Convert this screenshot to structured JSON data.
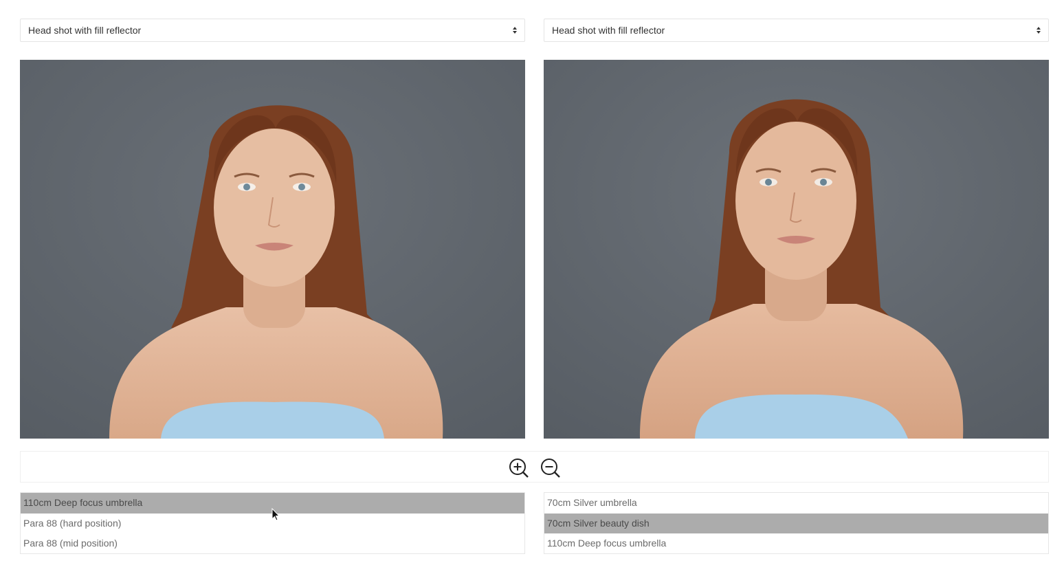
{
  "left": {
    "select_label": "Head shot with fill reflector",
    "options": [
      {
        "label": "110cm Deep focus umbrella",
        "selected": true
      },
      {
        "label": "Para 88 (hard position)",
        "selected": false
      },
      {
        "label": "Para 88 (mid position)",
        "selected": false
      }
    ]
  },
  "right": {
    "select_label": "Head shot with fill reflector",
    "options": [
      {
        "label": "70cm Silver umbrella",
        "selected": false
      },
      {
        "label": "70cm Silver beauty dish",
        "selected": true
      },
      {
        "label": "110cm Deep focus umbrella",
        "selected": false
      }
    ]
  },
  "toolbar": {
    "zoom_in_icon": "zoom-in-icon",
    "zoom_out_icon": "zoom-out-icon"
  },
  "colors": {
    "backdrop": "#62686f",
    "selected_row": "#acacac",
    "top_color": "#a9cfe8"
  }
}
